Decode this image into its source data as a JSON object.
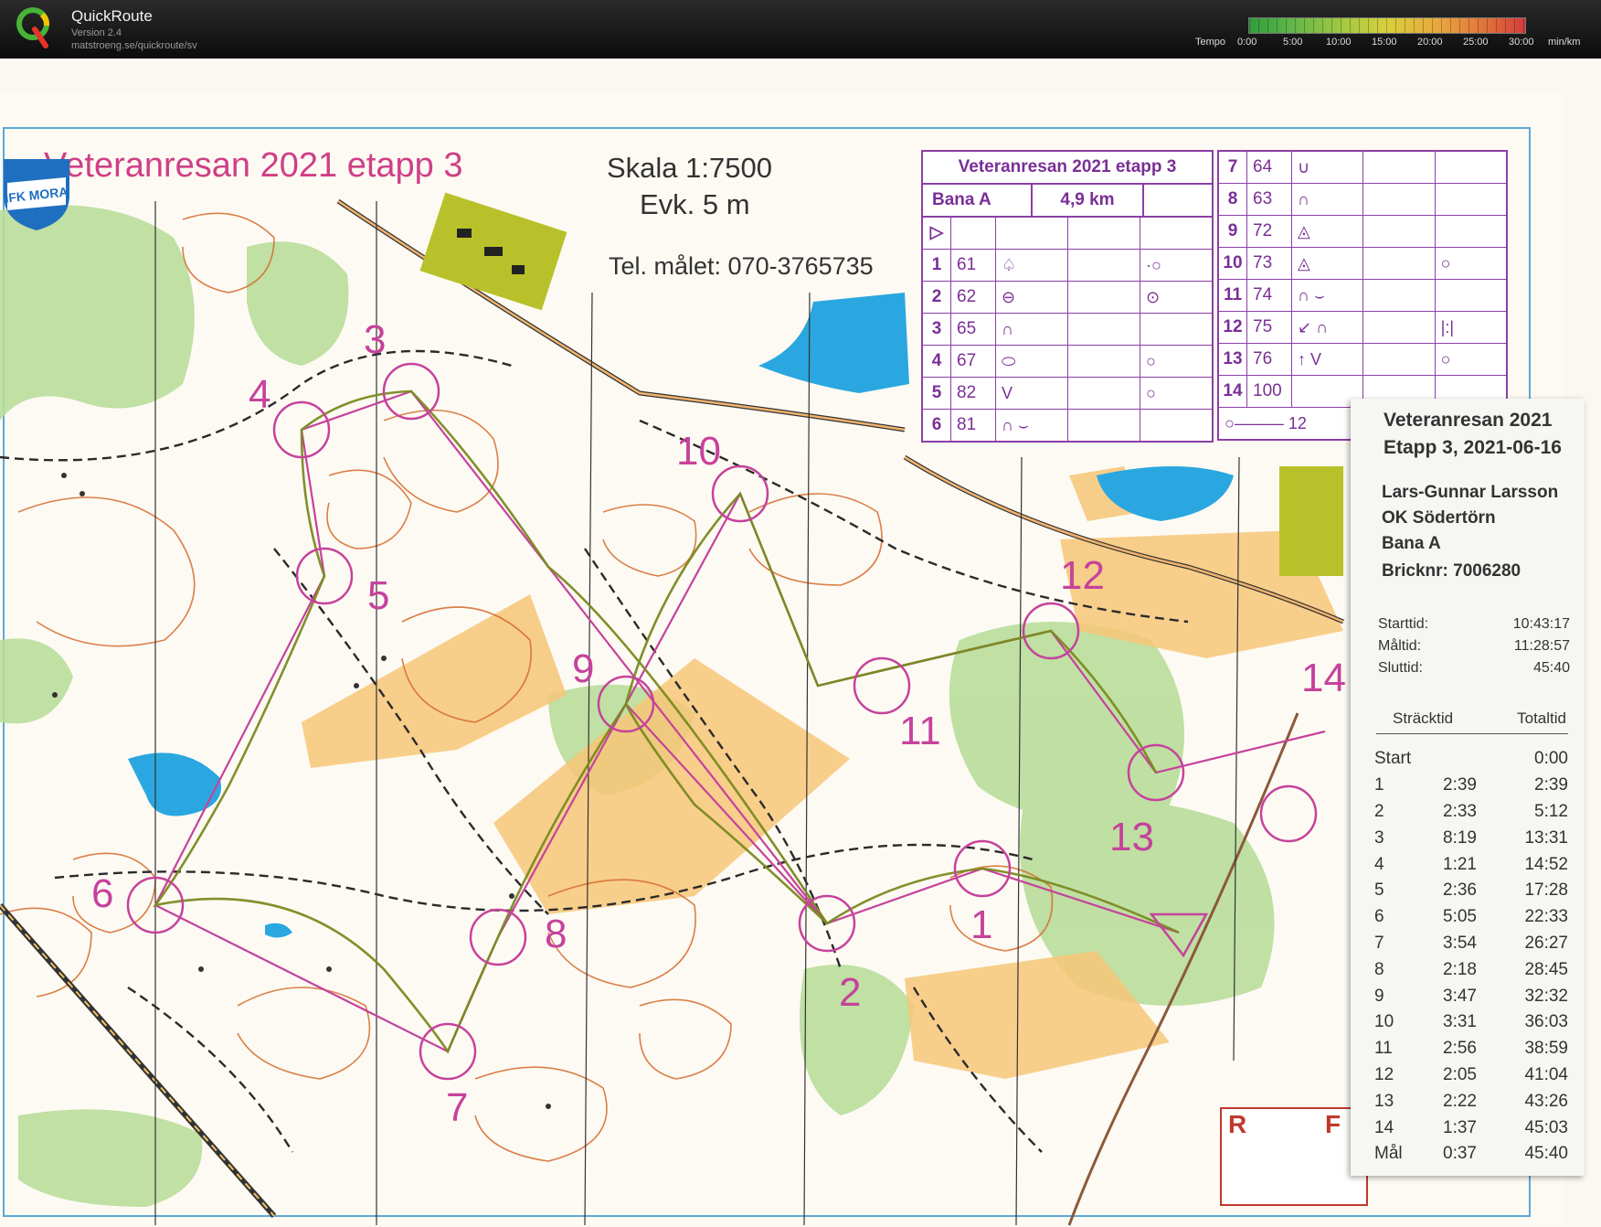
{
  "app": {
    "name": "QuickRoute",
    "version": "Version 2.4",
    "url": "matstroeng.se/quickroute/sv"
  },
  "tempo": {
    "label": "Tempo",
    "ticks": [
      "0:00",
      "5:00",
      "10:00",
      "15:00",
      "20:00",
      "25:00",
      "30:00"
    ],
    "unit": "min/km"
  },
  "map": {
    "title": "Veteranresan 2021 etapp 3",
    "scale": "Skala 1:7500",
    "contour": "Evk. 5 m",
    "phone": "Tel. målet: 070-3765735",
    "club_logo": "IFK MORA",
    "colors": {
      "course": "#c6429c",
      "contour": "#d46a2a",
      "water": "#2aa7e0",
      "open": "#f7c678",
      "green": "#b8dc9a",
      "route": "#7a8a20"
    },
    "controls": [
      {
        "label": "1"
      },
      {
        "label": "2"
      },
      {
        "label": "3"
      },
      {
        "label": "4"
      },
      {
        "label": "5"
      },
      {
        "label": "6"
      },
      {
        "label": "7"
      },
      {
        "label": "8"
      },
      {
        "label": "9"
      },
      {
        "label": "10"
      },
      {
        "label": "11"
      },
      {
        "label": "12"
      },
      {
        "label": "13"
      },
      {
        "label": "14"
      }
    ],
    "corner_labels": [
      "R",
      "F"
    ]
  },
  "descriptions": {
    "title": "Veteranresan 2021 etapp 3",
    "course": "Bana A",
    "length": "4,9 km",
    "left_rows": [
      {
        "num": "1",
        "code": "61"
      },
      {
        "num": "2",
        "code": "62"
      },
      {
        "num": "3",
        "code": "65"
      },
      {
        "num": "4",
        "code": "67"
      },
      {
        "num": "5",
        "code": "82"
      },
      {
        "num": "6",
        "code": "81"
      }
    ],
    "right_rows": [
      {
        "num": "7",
        "code": "64"
      },
      {
        "num": "8",
        "code": "63"
      },
      {
        "num": "9",
        "code": "72"
      },
      {
        "num": "10",
        "code": "73"
      },
      {
        "num": "11",
        "code": "74"
      },
      {
        "num": "12",
        "code": "75"
      },
      {
        "num": "13",
        "code": "76"
      },
      {
        "num": "14",
        "code": "100"
      }
    ],
    "finish_dist": "12"
  },
  "slip": {
    "event": "Veteranresan 2021",
    "stage": "Etapp 3, 2021-06-16",
    "runner": "Lars-Gunnar Larsson",
    "club": "OK Södertörn",
    "course": "Bana A",
    "chip": "Bricknr: 7006280",
    "start_label": "Starttid:",
    "start_value": "10:43:17",
    "finish_label": "Måltid:",
    "finish_value": "11:28:57",
    "result_label": "Sluttid:",
    "result_value": "45:40",
    "col_leg": "Sträcktid",
    "col_total": "Totaltid",
    "splits": [
      {
        "ctrl": "Start",
        "leg": "",
        "total": "0:00"
      },
      {
        "ctrl": "1",
        "leg": "2:39",
        "total": "2:39"
      },
      {
        "ctrl": "2",
        "leg": "2:33",
        "total": "5:12"
      },
      {
        "ctrl": "3",
        "leg": "8:19",
        "total": "13:31"
      },
      {
        "ctrl": "4",
        "leg": "1:21",
        "total": "14:52"
      },
      {
        "ctrl": "5",
        "leg": "2:36",
        "total": "17:28"
      },
      {
        "ctrl": "6",
        "leg": "5:05",
        "total": "22:33"
      },
      {
        "ctrl": "7",
        "leg": "3:54",
        "total": "26:27"
      },
      {
        "ctrl": "8",
        "leg": "2:18",
        "total": "28:45"
      },
      {
        "ctrl": "9",
        "leg": "3:47",
        "total": "32:32"
      },
      {
        "ctrl": "10",
        "leg": "3:31",
        "total": "36:03"
      },
      {
        "ctrl": "11",
        "leg": "2:56",
        "total": "38:59"
      },
      {
        "ctrl": "12",
        "leg": "2:05",
        "total": "41:04"
      },
      {
        "ctrl": "13",
        "leg": "2:22",
        "total": "43:26"
      },
      {
        "ctrl": "14",
        "leg": "1:37",
        "total": "45:03"
      },
      {
        "ctrl": "Mål",
        "leg": "0:37",
        "total": "45:40"
      }
    ]
  }
}
